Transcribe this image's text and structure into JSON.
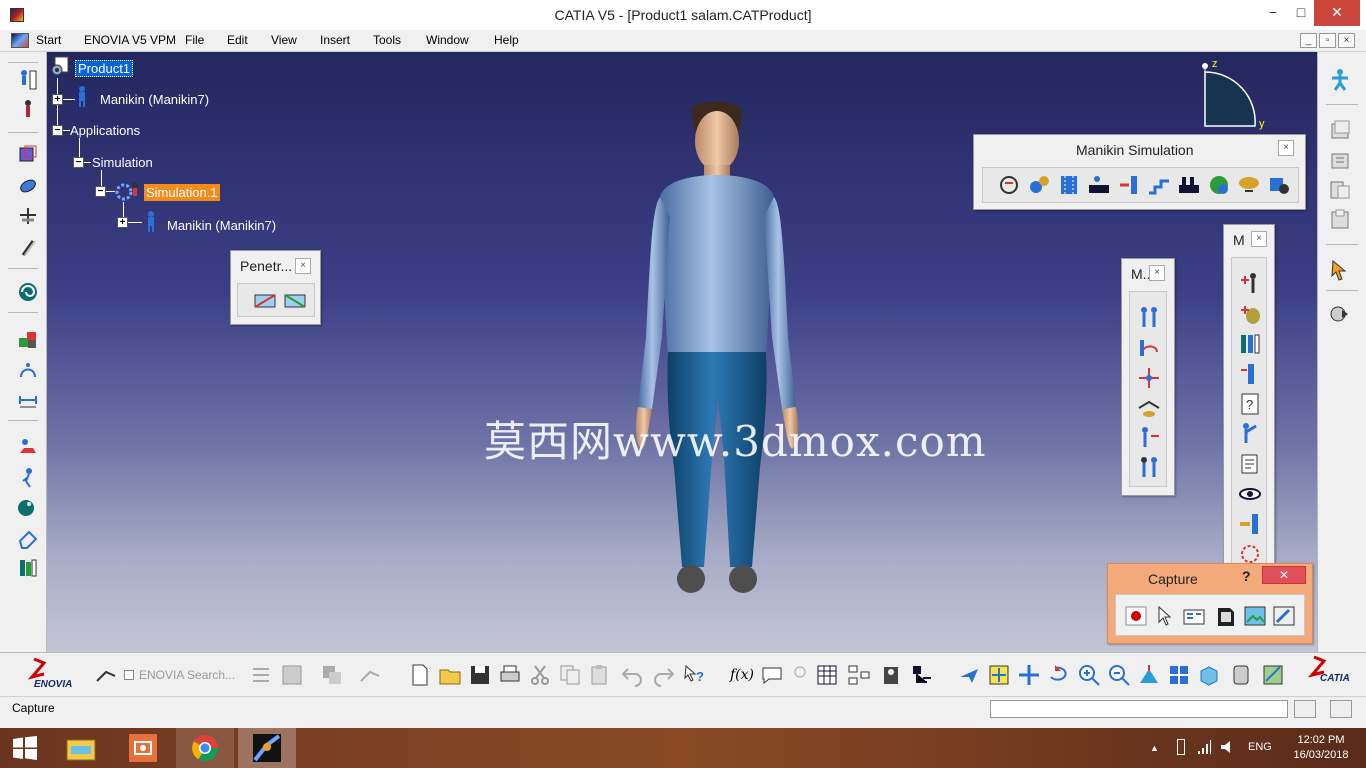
{
  "window": {
    "title": "CATIA V5 - [Product1 salam.CATProduct]",
    "minimize": "−",
    "maximize": "□",
    "close": "✕"
  },
  "menu": {
    "items": [
      "Start",
      "ENOVIA V5 VPM",
      "File",
      "Edit",
      "View",
      "Insert",
      "Tools",
      "Window",
      "Help"
    ]
  },
  "tree": {
    "root": "Product1",
    "manikin1": "Manikin (Manikin7)",
    "applications": "Applications",
    "simulation": "Simulation",
    "simulation1": "Simulation.1",
    "manikin2": "Manikin (Manikin7)"
  },
  "compass": {
    "z": "z",
    "y": "y"
  },
  "panels": {
    "penetration": {
      "title": "Penetr...",
      "close": "×"
    },
    "manikin_simulation": {
      "title": "Manikin Simulation",
      "close": "×"
    },
    "m_small": {
      "title": "M..",
      "close": "×"
    },
    "m_tall": {
      "title": "M",
      "close": "×"
    },
    "capture": {
      "title": "Capture",
      "help": "?",
      "close": "✕"
    }
  },
  "watermark": "莫西网www.3dmox.com",
  "bottom": {
    "enovia_search": "ENOVIA Search...",
    "enovia_logo": "ENOVIA",
    "catia_logo": "CATIA",
    "formula": "f(x)"
  },
  "status": {
    "text": "Capture",
    "input": ""
  },
  "taskbar": {
    "lang": "ENG",
    "time": "12:02 PM",
    "date": "16/03/2018"
  },
  "colors": {
    "viewport_top": "#24265e",
    "selection": "#0a64d6",
    "simulation_highlight": "#f28c1c"
  }
}
